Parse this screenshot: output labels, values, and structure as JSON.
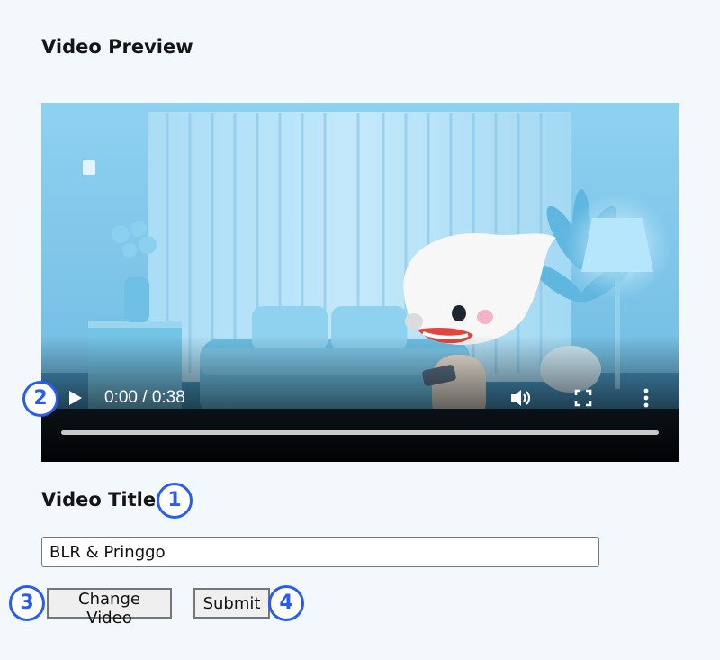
{
  "page": {
    "preview_heading": "Video Preview",
    "title_heading": "Video Title"
  },
  "video": {
    "time_display": "0:00 / 0:38",
    "progress": 0,
    "icons": {
      "play": "play-icon",
      "volume": "volume-icon",
      "fullscreen": "fullscreen-icon",
      "more": "more-options-icon"
    }
  },
  "form": {
    "title_value": "BLR & Pringgo",
    "change_video_label": "Change Video",
    "submit_label": "Submit"
  },
  "markers": [
    "1",
    "2",
    "3",
    "4"
  ],
  "colors": {
    "background": "#f3f8fd",
    "marker_blue": "#2a5cf0",
    "scene_blue": "#7fc7ea"
  }
}
